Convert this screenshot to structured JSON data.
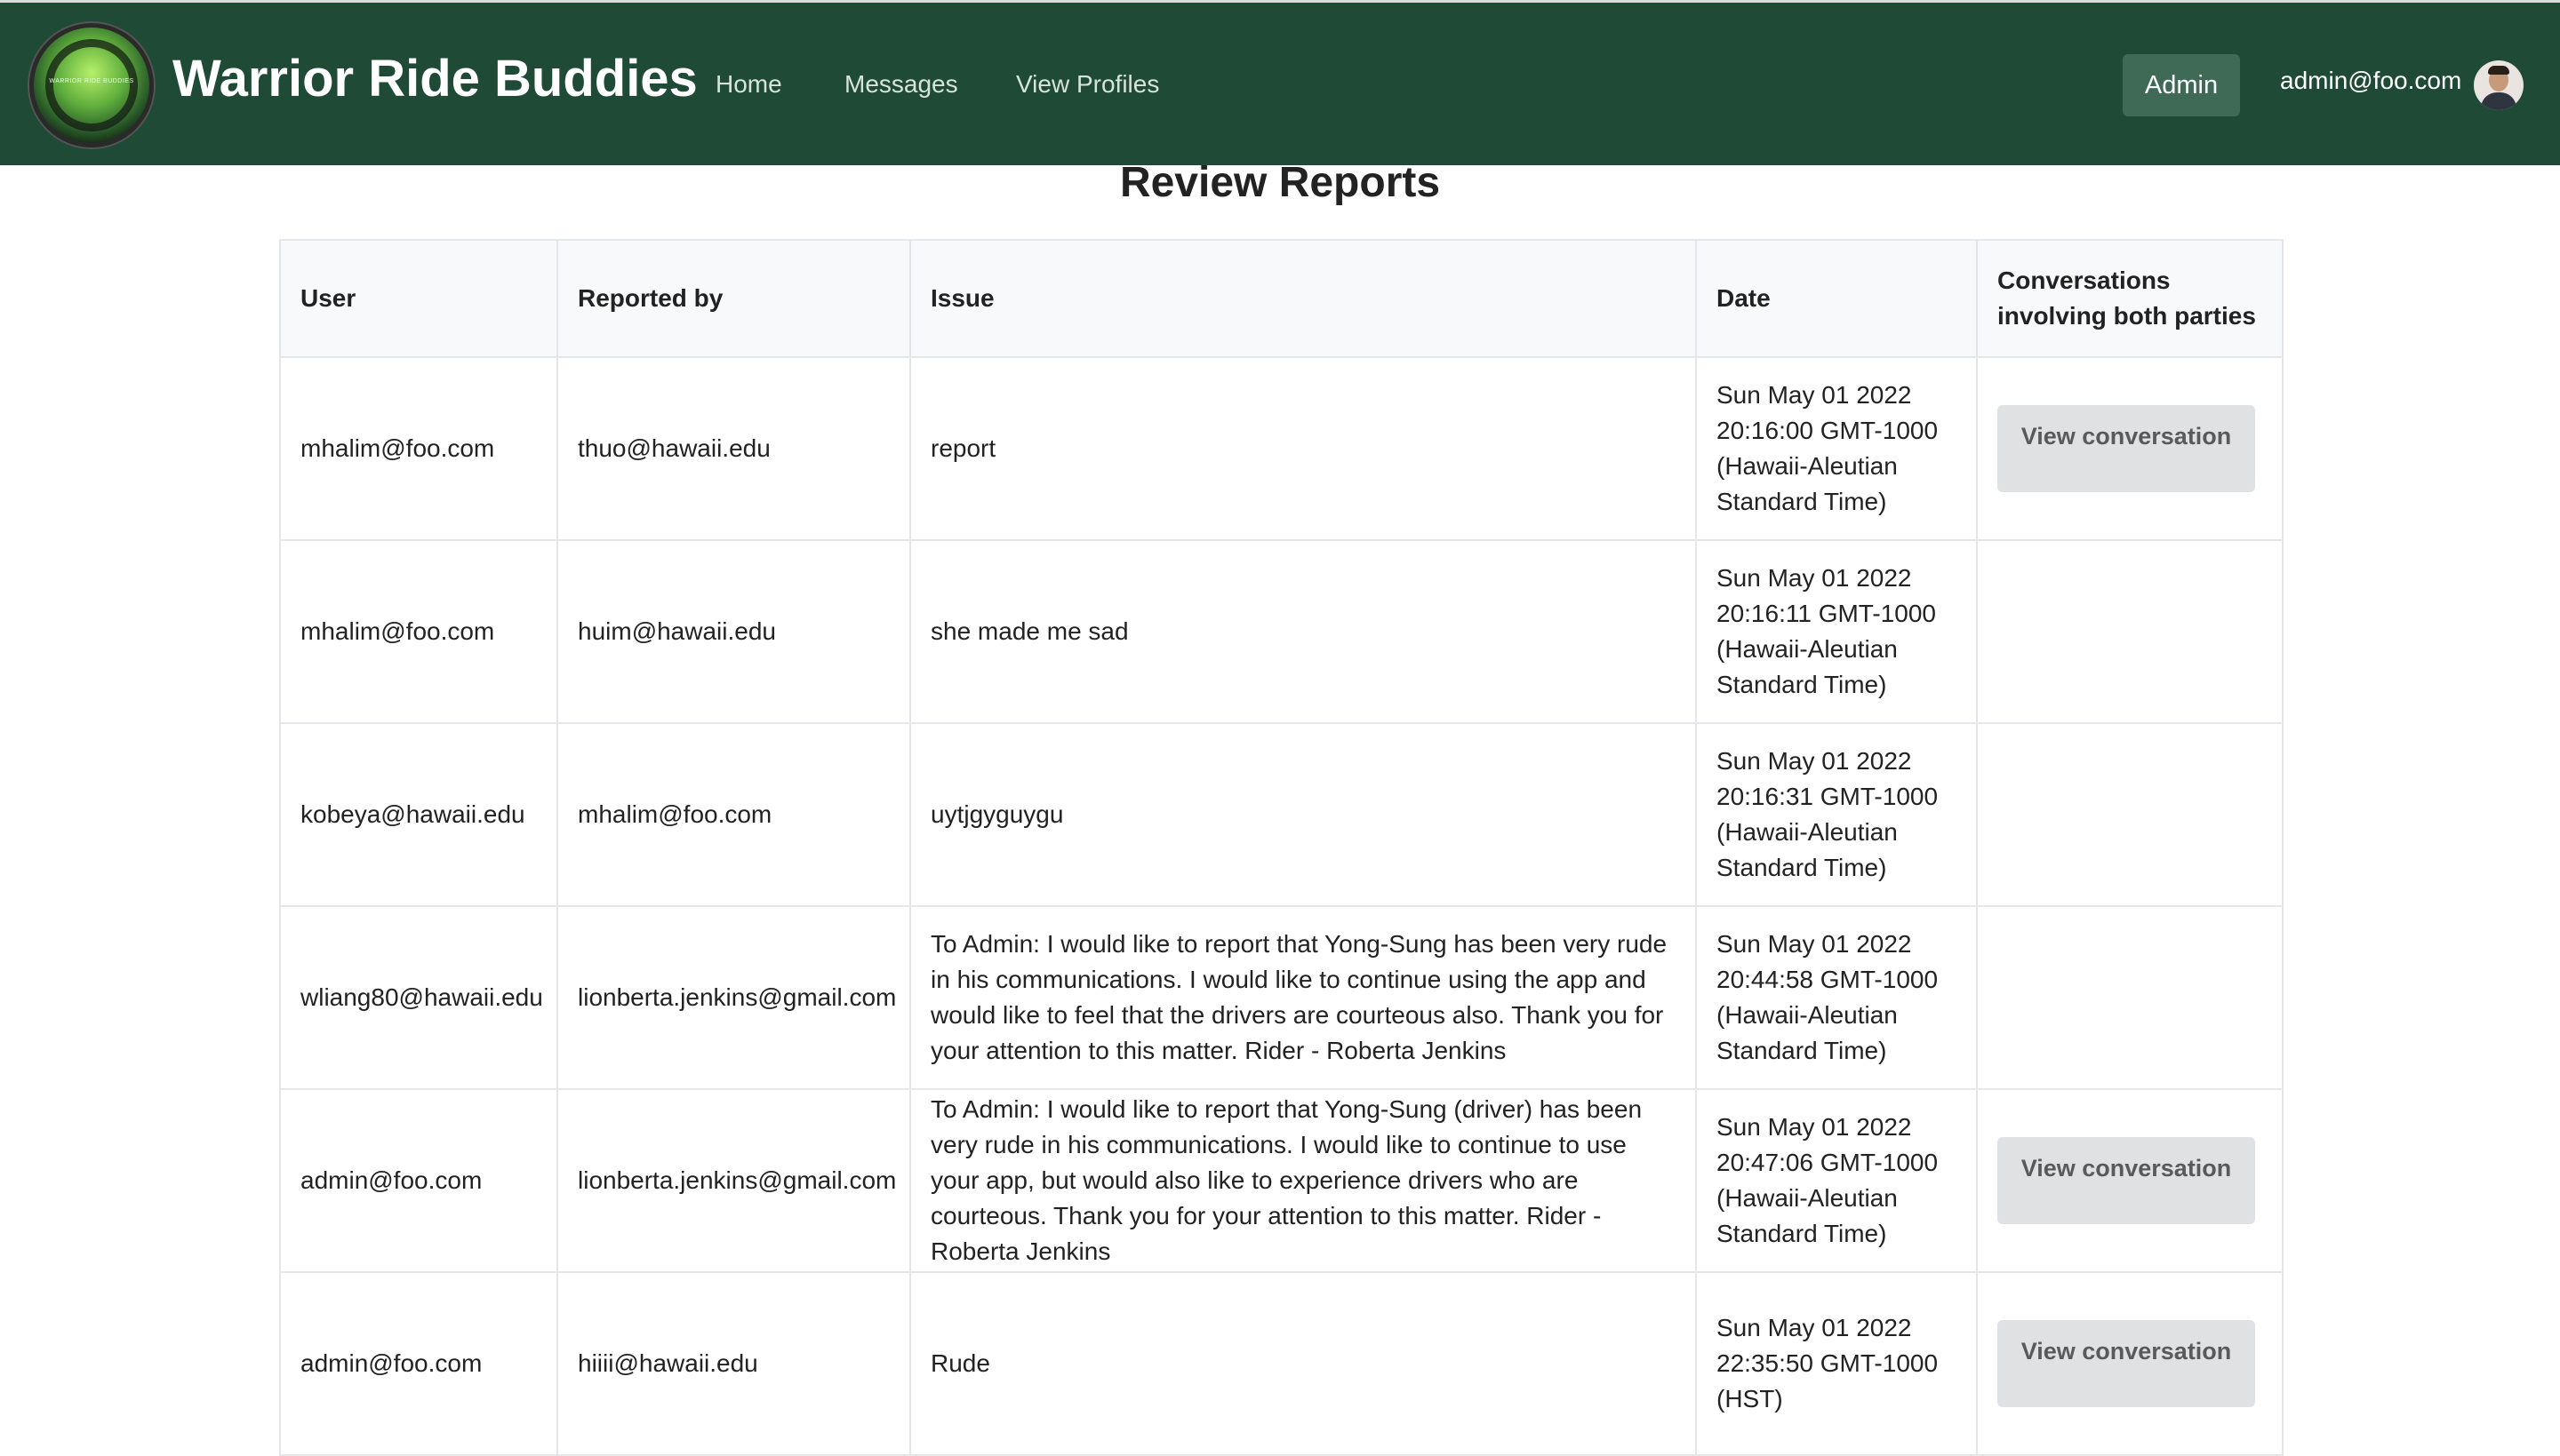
{
  "navbar": {
    "logo_text": "WARRIOR RIDE BUDDIES",
    "brand": "Warrior Ride Buddies",
    "links": [
      "Home",
      "Messages",
      "View Profiles"
    ],
    "admin_label": "Admin",
    "user_email": "admin@foo.com",
    "background": "#1e4a36"
  },
  "page": {
    "title": "Review Reports"
  },
  "table": {
    "headers": [
      "User",
      "Reported by",
      "Issue",
      "Date",
      "Conversations involving both parties"
    ],
    "view_button_label": "View conversation",
    "rows": [
      {
        "user": "mhalim@foo.com",
        "reported_by": "thuo@hawaii.edu",
        "issue": "report",
        "date": "Sun May 01 2022 20:16:00 GMT-1000 (Hawaii-Aleutian Standard Time)",
        "has_conversation": true
      },
      {
        "user": "mhalim@foo.com",
        "reported_by": "huim@hawaii.edu",
        "issue": "she made me sad",
        "date": "Sun May 01 2022 20:16:11 GMT-1000 (Hawaii-Aleutian Standard Time)",
        "has_conversation": false
      },
      {
        "user": "kobeya@hawaii.edu",
        "reported_by": "mhalim@foo.com",
        "issue": "uytjgyguygu",
        "date": "Sun May 01 2022 20:16:31 GMT-1000 (Hawaii-Aleutian Standard Time)",
        "has_conversation": false
      },
      {
        "user": "wliang80@hawaii.edu",
        "reported_by": "lionberta.jenkins@gmail.com",
        "issue": "To Admin: I would like to report that Yong-Sung has been very rude in his communications. I would like to continue using the app and would like to feel that the drivers are courteous also. Thank you for your attention to this matter. Rider - Roberta Jenkins",
        "date": "Sun May 01 2022 20:44:58 GMT-1000 (Hawaii-Aleutian Standard Time)",
        "has_conversation": false
      },
      {
        "user": "admin@foo.com",
        "reported_by": "lionberta.jenkins@gmail.com",
        "issue": "To Admin: I would like to report that Yong-Sung (driver) has been very rude in his communications. I would like to continue to use your app, but would also like to experience drivers who are courteous. Thank you for your attention to this matter. Rider - Roberta Jenkins",
        "date": "Sun May 01 2022 20:47:06 GMT-1000 (Hawaii-Aleutian Standard Time)",
        "has_conversation": true
      },
      {
        "user": "admin@foo.com",
        "reported_by": "hiiii@hawaii.edu",
        "issue": "Rude",
        "date": "Sun May 01 2022 22:35:50 GMT-1000 (HST)",
        "has_conversation": true
      }
    ]
  }
}
